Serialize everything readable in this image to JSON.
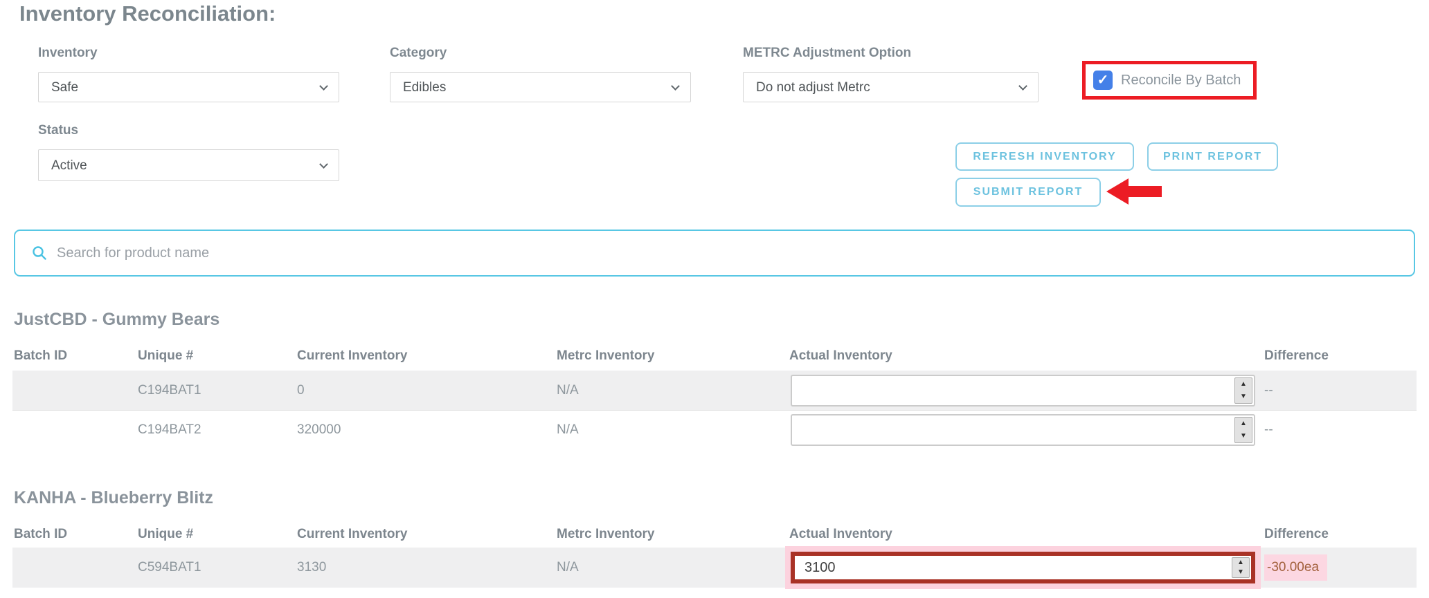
{
  "page": {
    "title": "Inventory Reconciliation:"
  },
  "filters": {
    "inventory": {
      "label": "Inventory",
      "value": "Safe"
    },
    "category": {
      "label": "Category",
      "value": "Edibles"
    },
    "metrc_option": {
      "label": "METRC Adjustment Option",
      "value": "Do not adjust Metrc"
    },
    "status": {
      "label": "Status",
      "value": "Active"
    },
    "reconcile_by_batch": {
      "label": "Reconcile By Batch",
      "checked": "true",
      "checkmark": "✓"
    }
  },
  "actions": {
    "refresh": "REFRESH INVENTORY",
    "print": "PRINT REPORT",
    "submit": "SUBMIT REPORT"
  },
  "search": {
    "placeholder": "Search for product name"
  },
  "table_headers": {
    "batch_id": "Batch ID",
    "unique": "Unique #",
    "current": "Current Inventory",
    "metrc": "Metrc Inventory",
    "actual": "Actual Inventory",
    "difference": "Difference"
  },
  "spinner": {
    "up": "▲",
    "down": "▼"
  },
  "sections": [
    {
      "product": "JustCBD - Gummy Bears",
      "rows": [
        {
          "batch_id": "",
          "unique": "C194BAT1",
          "current": "0",
          "metrc": "N/A",
          "actual_value": "",
          "difference": "--"
        },
        {
          "batch_id": "",
          "unique": "C194BAT2",
          "current": "320000",
          "metrc": "N/A",
          "actual_value": "",
          "difference": "--"
        }
      ]
    },
    {
      "product": "KANHA - Blueberry Blitz",
      "rows": [
        {
          "batch_id": "",
          "unique": "C594BAT1",
          "current": "3130",
          "metrc": "N/A",
          "actual_value": "3100",
          "difference": "-30.00ea"
        }
      ]
    }
  ],
  "colors": {
    "accent_cyan": "#58c7e4",
    "annotation_red": "#ec1c24",
    "annotation_dark_red": "#a93226",
    "annotation_pink": "#fcd2de",
    "checkbox_blue": "#4480e8",
    "difference_negative": "#a2603c",
    "row_gray": "#efeff0",
    "text_gray": "#7e8890"
  }
}
